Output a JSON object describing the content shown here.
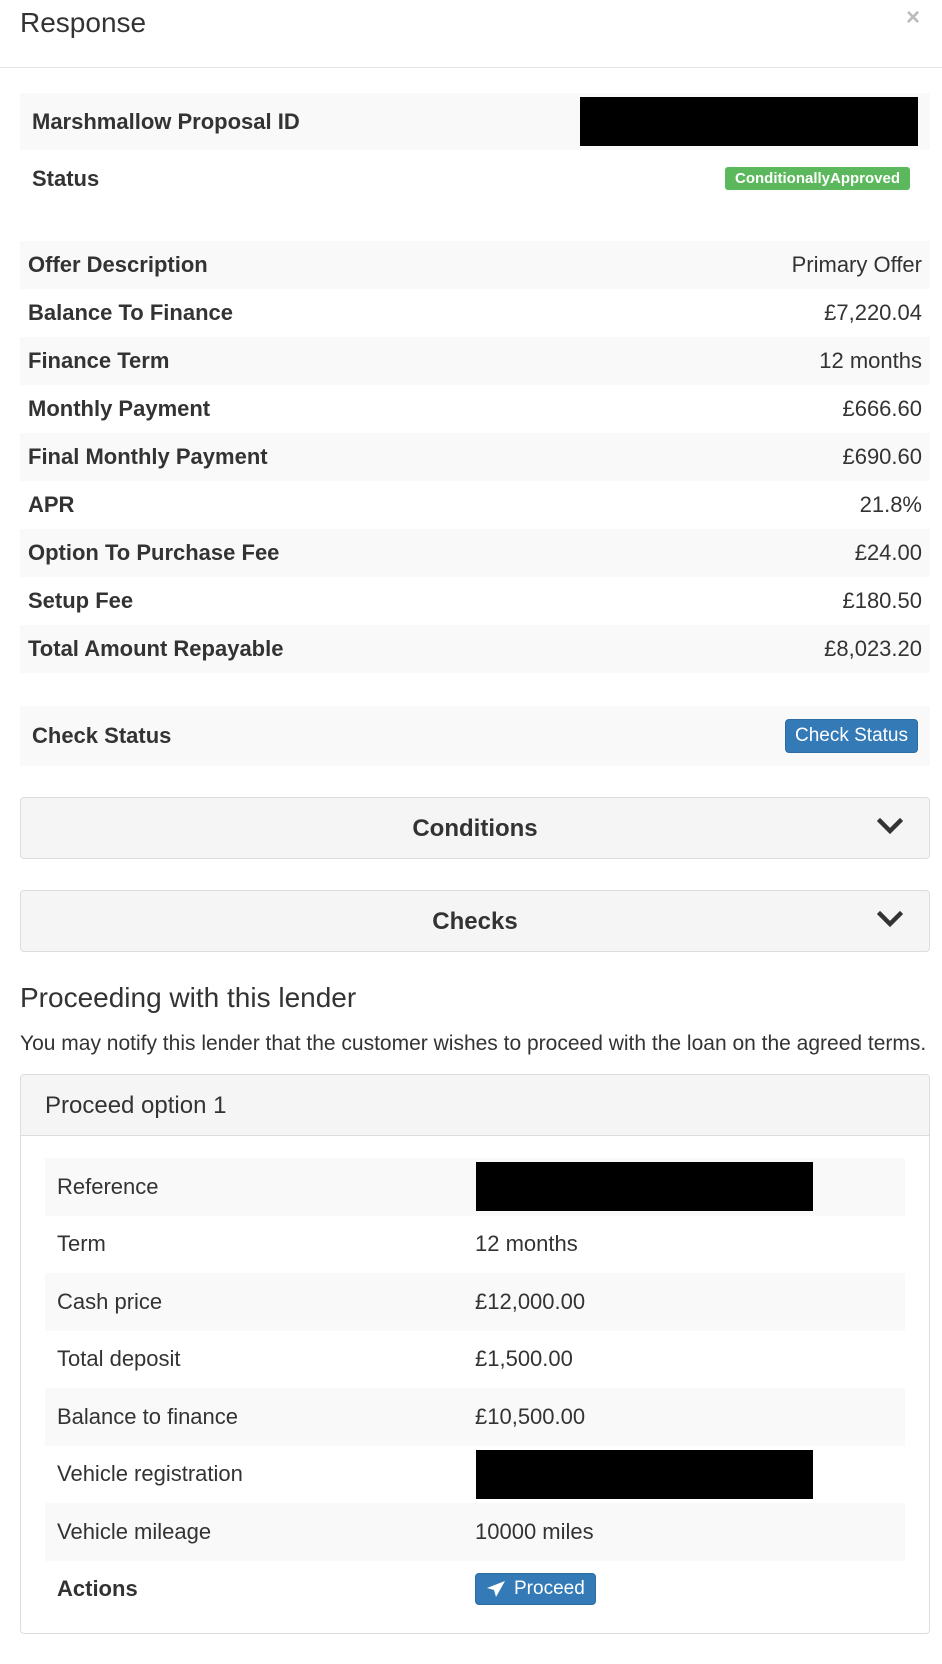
{
  "modal": {
    "title": "Response",
    "close_label": "×"
  },
  "proposal": {
    "id_label": "Marshmallow Proposal ID",
    "status_label": "Status",
    "status_value": "ConditionallyApproved"
  },
  "offer_rows": [
    {
      "label": "Offer Description",
      "value": "Primary Offer"
    },
    {
      "label": "Balance To Finance",
      "value": "£7,220.04"
    },
    {
      "label": "Finance Term",
      "value": "12 months"
    },
    {
      "label": "Monthly Payment",
      "value": "£666.60"
    },
    {
      "label": "Final Monthly Payment",
      "value": "£690.60"
    },
    {
      "label": "APR",
      "value": "21.8%"
    },
    {
      "label": "Option To Purchase Fee",
      "value": "£24.00"
    },
    {
      "label": "Setup Fee",
      "value": "£180.50"
    },
    {
      "label": "Total Amount Repayable",
      "value": "£8,023.20"
    }
  ],
  "check_status": {
    "label": "Check Status",
    "button": "Check Status"
  },
  "collapsibles": {
    "conditions": "Conditions",
    "checks": "Checks"
  },
  "proceeding": {
    "heading": "Proceeding with this lender",
    "description": "You may notify this lender that the customer wishes to proceed with the loan on the agreed terms."
  },
  "proceed_option": {
    "title": "Proceed option 1",
    "rows": [
      {
        "label": "Reference",
        "value": ""
      },
      {
        "label": "Term",
        "value": "12 months"
      },
      {
        "label": "Cash price",
        "value": "£12,000.00"
      },
      {
        "label": "Total deposit",
        "value": "£1,500.00"
      },
      {
        "label": "Balance to finance",
        "value": "£10,500.00"
      },
      {
        "label": "Vehicle registration",
        "value": ""
      },
      {
        "label": "Vehicle mileage",
        "value": "10000 miles"
      }
    ],
    "actions_label": "Actions",
    "proceed_button": "Proceed"
  },
  "colors": {
    "primary": "#337ab7",
    "success": "#5cb85c",
    "stripe": "#f9f9f9"
  },
  "icons": {
    "close": "close-icon",
    "chevron": "chevron-down-icon",
    "send": "paper-plane-icon"
  }
}
